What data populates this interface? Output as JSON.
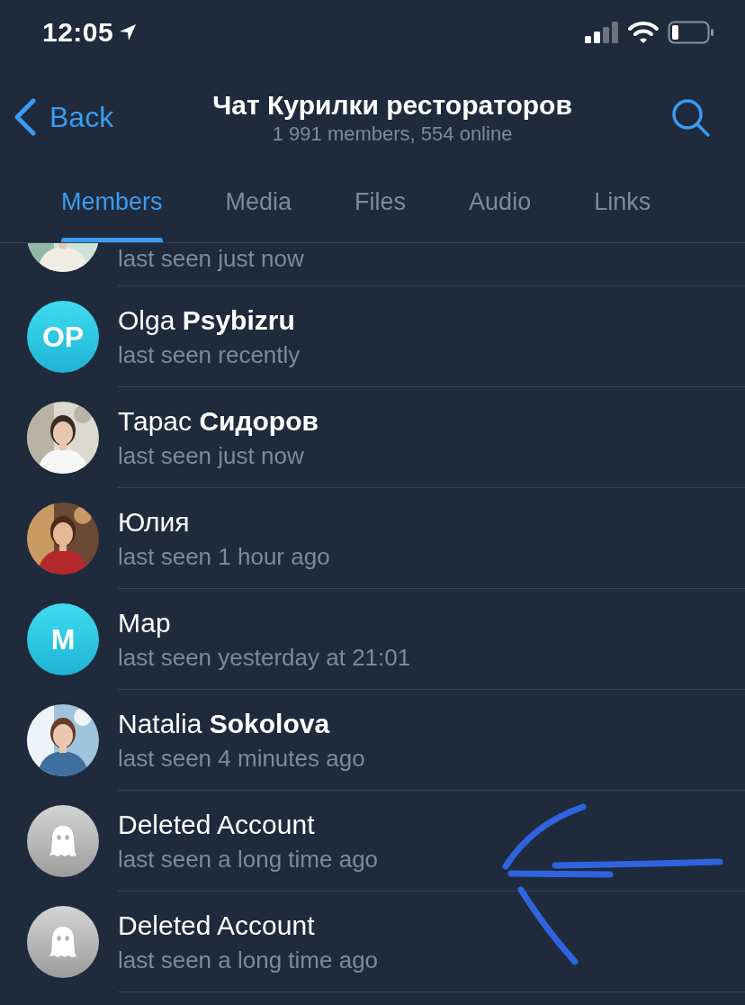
{
  "status_bar": {
    "time": "12:05"
  },
  "header": {
    "back": "Back",
    "title": "Чат Курилки рестораторов",
    "subtitle": "1 991 members, 554 online"
  },
  "tabs": [
    {
      "label": "Members",
      "selected": true
    },
    {
      "label": "Media",
      "selected": false
    },
    {
      "label": "Files",
      "selected": false
    },
    {
      "label": "Audio",
      "selected": false
    },
    {
      "label": "Links",
      "selected": false
    }
  ],
  "members": [
    {
      "status": "last seen just now"
    },
    {
      "name": "Olga **Psybizru**",
      "avatar": {
        "kind": "initials",
        "initials": "OP"
      },
      "status": "last seen recently"
    },
    {
      "name": "Тарас **Сидоров**",
      "status": "last seen just now"
    },
    {
      "name": "Юлия",
      "status": "last seen 1 hour ago"
    },
    {
      "name": "Мар",
      "avatar": {
        "kind": "initials",
        "initials": "M"
      },
      "status": "last seen yesterday at 21:01"
    },
    {
      "name": "Natalia **Sokolova**",
      "status": "last seen 4 minutes ago"
    },
    {
      "name": "Deleted Account",
      "avatar": {
        "kind": "ghost"
      },
      "status": "last seen a long time ago"
    },
    {
      "name": "Deleted Account",
      "avatar": {
        "kind": "ghost"
      },
      "status": "last seen a long time ago"
    }
  ],
  "annotation": {
    "kind": "arrow"
  }
}
